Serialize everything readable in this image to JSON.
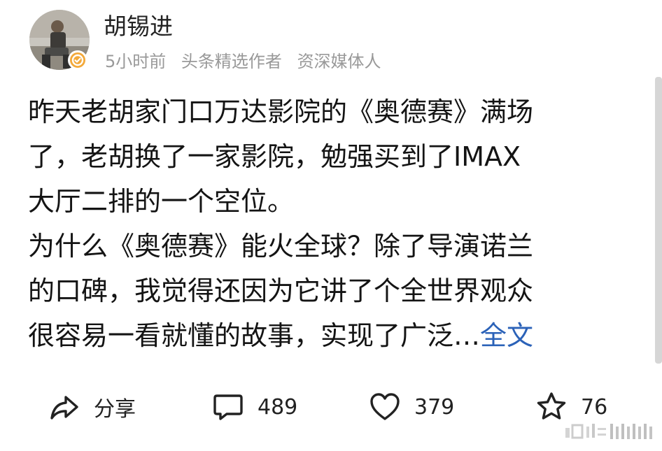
{
  "author": {
    "name": "胡锡进",
    "time": "5小时前",
    "tag1": "头条精选作者",
    "tag2": "资深媒体人",
    "avatar_icon": "avatar-photo-icon",
    "badge_icon": "verified-badge-icon",
    "badge_color": "#f3a93a"
  },
  "post": {
    "line1": "昨天老胡家门口万达影院的《奥德赛》满场",
    "line2": "了，老胡换了一家影院，勉强买到了IMAX",
    "line3": "大厅二排的一个空位。",
    "line4": "为什么《奥德赛》能火全球？除了导演诺兰",
    "line5": "的口碑，我觉得还因为它讲了个全世界观众",
    "line6": "很容易一看就懂的故事，实现了广泛…",
    "more_label": "全文",
    "link_color": "#2b62b8"
  },
  "actions": {
    "share_label": "分享",
    "comments": "489",
    "likes": "379",
    "favorites": "76"
  }
}
